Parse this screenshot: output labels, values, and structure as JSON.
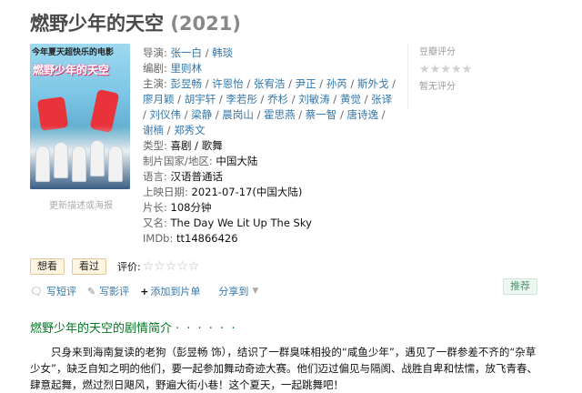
{
  "title": {
    "name": "燃野少年的天空",
    "year": "(2021)"
  },
  "poster": {
    "top_text": "今年夏天超快乐的电影",
    "name_text": "燃野少年的天空",
    "more_desc_label": "更新描述或海报"
  },
  "info": {
    "director_label": "导演:",
    "directors": [
      "张一白",
      "韩琰"
    ],
    "writer_label": "编剧:",
    "writers": [
      "里则林"
    ],
    "cast_label": "主演:",
    "cast": [
      "彭昱畅",
      "许恩怡",
      "张宥浩",
      "尹正",
      "孙芮",
      "斯外戈",
      "廖月颖",
      "胡宇轩",
      "李若彤",
      "乔杉",
      "刘敏涛",
      "黄觉",
      "张译",
      "刘仪伟",
      "梁静",
      "晨岗山",
      "霍思燕",
      "蔡一智",
      "唐诗逸",
      "谢楠",
      "郑秀文"
    ],
    "genre_label": "类型:",
    "genre_value": "喜剧 / 歌舞",
    "country_label": "制片国家/地区:",
    "country_value": "中国大陆",
    "language_label": "语言:",
    "language_value": "汉语普通话",
    "release_label": "上映日期:",
    "release_value": "2021-07-17(中国大陆)",
    "runtime_label": "片长:",
    "runtime_value": "108分钟",
    "aka_label": "又名:",
    "aka_value": "The Day We Lit Up The Sky",
    "imdb_label": "IMDb:",
    "imdb_value": "tt14866426"
  },
  "rating": {
    "label": "豆瓣评分",
    "stars": "★★★★★",
    "no_rating": "暂无评分"
  },
  "buttons": {
    "want": "想看",
    "seen": "看过",
    "rate_label": "评价:",
    "rate_stars": "☆☆☆☆☆"
  },
  "actions": {
    "short_review": "写短评",
    "review": "写影评",
    "add_to_list": "添加到片单",
    "share": "分享到",
    "recommend": "推荐"
  },
  "summary": {
    "title": "燃野少年的天空的剧情简介",
    "dots": "· · · · · ·",
    "text": "只身来到海南复读的老狗（彭昱畅 饰），结识了一群臭味相投的“咸鱼少年”，遇见了一群参差不齐的“杂草少女”，缺乏自知之明的他们，要一起参加舞动奇迹大赛。他们迈过偏见与隔阂、战胜自卑和怯懦，放飞青春、肆意起舞，燃过烈日飓风，野遍大街小巷！这个夏天，一起跳舞吧！"
  },
  "colors": {
    "link": "#3377aa",
    "section_green": "#007722",
    "button_bg": "#fff5e0"
  },
  "icons": {
    "short_review": "comment-icon",
    "review": "pencil-icon",
    "add": "plus-icon",
    "share_caret": "caret-down-icon"
  }
}
